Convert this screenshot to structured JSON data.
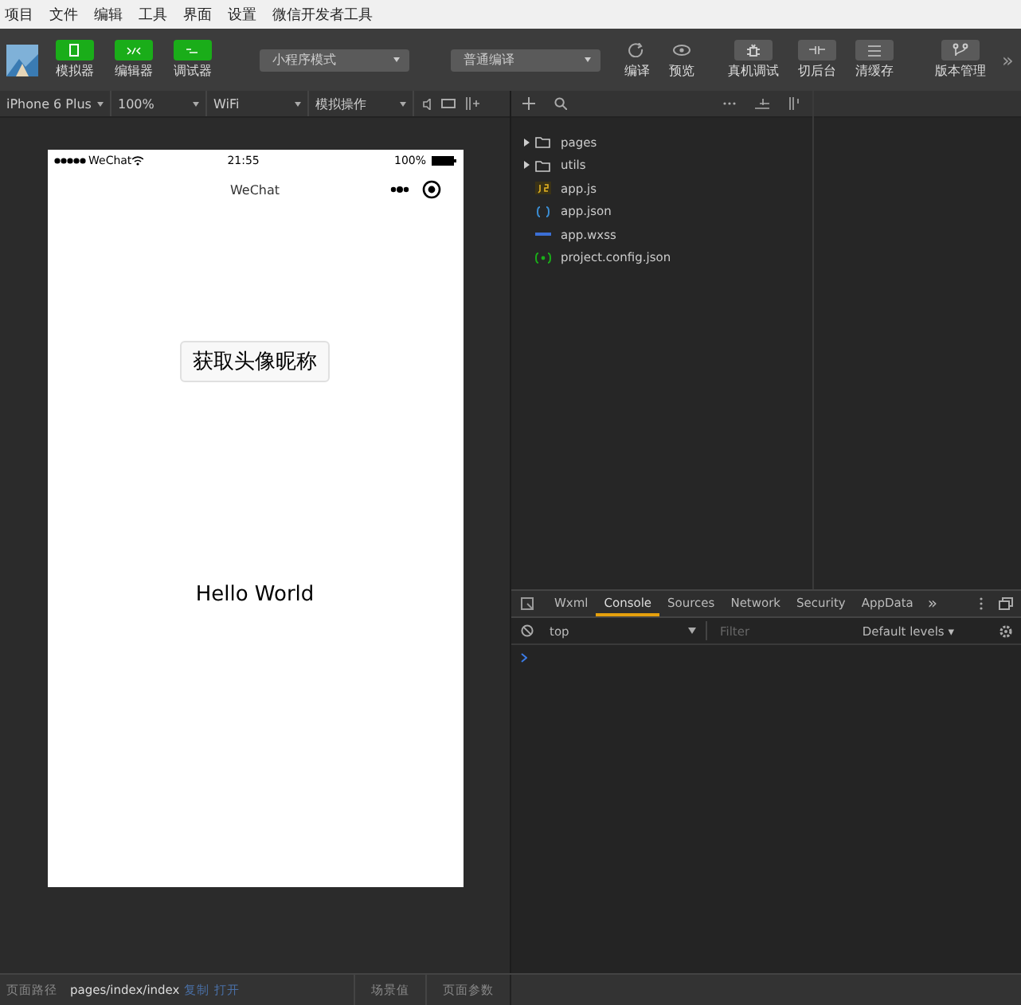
{
  "menu": [
    "项目",
    "文件",
    "编辑",
    "工具",
    "界面",
    "设置",
    "微信开发者工具"
  ],
  "toolbar": {
    "mode_buttons": [
      {
        "label": "模拟器",
        "on": true
      },
      {
        "label": "编辑器",
        "on": true
      },
      {
        "label": "调试器",
        "on": true
      }
    ],
    "mode_select": "小程序模式",
    "compile_select": "普通编译",
    "actions": [
      {
        "label": "编译",
        "kind": "refresh"
      },
      {
        "label": "预览",
        "kind": "eye"
      },
      {
        "label": "真机调试",
        "kind": "bug"
      },
      {
        "label": "切后台",
        "kind": "switch"
      },
      {
        "label": "清缓存",
        "kind": "layers"
      },
      {
        "label": "版本管理",
        "kind": "branch"
      }
    ],
    "more": "»"
  },
  "sim_bar": {
    "device": "iPhone 6 Plus",
    "zoom": "100%",
    "network": "WiFi",
    "operation": "模拟操作"
  },
  "phone": {
    "carrier": "WeChat",
    "time": "21:55",
    "battery": "100%",
    "nav_title": "WeChat",
    "button": "获取头像昵称",
    "text": "Hello World"
  },
  "files": [
    {
      "name": "pages",
      "kind": "folder",
      "expanded": false
    },
    {
      "name": "utils",
      "kind": "folder",
      "expanded": false
    },
    {
      "name": "app.js",
      "kind": "js"
    },
    {
      "name": "app.json",
      "kind": "json"
    },
    {
      "name": "app.wxss",
      "kind": "wxss"
    },
    {
      "name": "project.config.json",
      "kind": "config"
    }
  ],
  "devtools": {
    "tabs": [
      {
        "label": "Wxml",
        "selected": false
      },
      {
        "label": "Console",
        "selected": true
      },
      {
        "label": "Sources",
        "selected": false
      },
      {
        "label": "Network",
        "selected": false
      },
      {
        "label": "Security",
        "selected": false
      },
      {
        "label": "AppData",
        "selected": false
      }
    ],
    "more": "»",
    "context": "top",
    "filter_placeholder": "Filter",
    "levels": "Default levels ▾"
  },
  "status_bar": {
    "label": "页面路径",
    "path": "pages/index/index",
    "links": [
      "复制",
      "打开"
    ],
    "scene": "场景值",
    "params": "页面参数"
  }
}
